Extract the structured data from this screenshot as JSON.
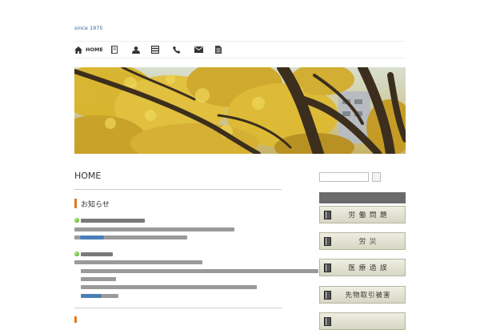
{
  "header": {
    "since": "since 1975"
  },
  "nav": {
    "items": [
      {
        "label": "HOME",
        "icon": "home-icon"
      },
      {
        "label": "",
        "icon": "book-icon"
      },
      {
        "label": "",
        "icon": "person-icon"
      },
      {
        "label": "",
        "icon": "list-icon"
      },
      {
        "label": "",
        "icon": "phone-icon"
      },
      {
        "label": "",
        "icon": "mail-icon"
      },
      {
        "label": "",
        "icon": "document-icon"
      }
    ]
  },
  "banner": {
    "subject": "yellow ginkgo tree branches against sky"
  },
  "main": {
    "page_title": "HOME",
    "section_title": "お知らせ"
  },
  "sidebar": {
    "search_value": "",
    "search_button": "",
    "buttons": [
      {
        "label": "労 働 問 題"
      },
      {
        "label": "労    災"
      },
      {
        "label": "医 療 過 誤"
      },
      {
        "label": "先物取引被害"
      },
      {
        "label": ""
      }
    ]
  },
  "colors": {
    "accent_orange": "#e07a1f",
    "link_blue": "#2a6aa0",
    "sidebar_header": "#6b6b6b",
    "button_bg": "#e4e4d4"
  }
}
